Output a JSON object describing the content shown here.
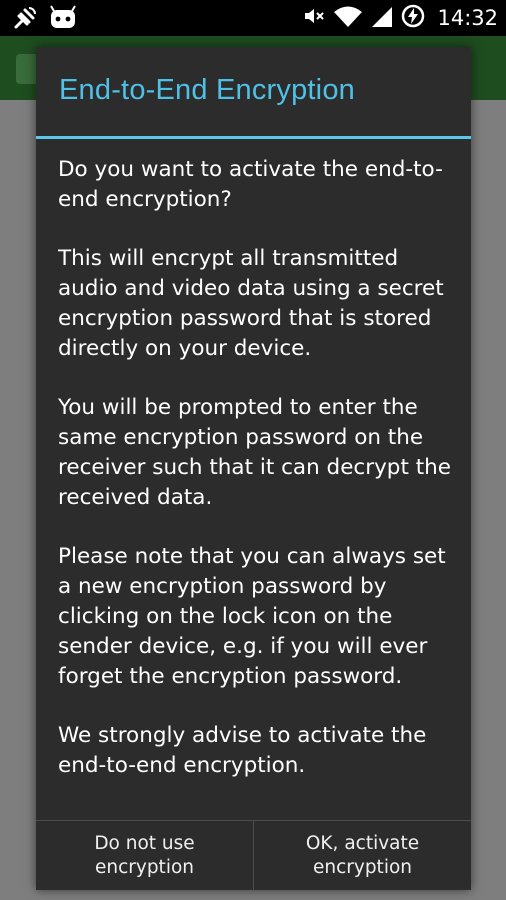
{
  "status_bar": {
    "time": "14:32",
    "icons": [
      "satellite-signal-icon",
      "android-face-icon",
      "mute-icon",
      "wifi-signal-icon",
      "battery-charging-icon"
    ]
  },
  "dialog": {
    "title": "End-to-End Encryption",
    "accent_color": "#4fc0e6",
    "paragraphs": [
      "Do you want to activate the end-to-end encryption?",
      "This will encrypt all transmitted audio and video data using a secret encryption password that is stored directly on your device.",
      "You will be prompted to enter the same encryption password on the receiver such that it can decrypt the received data.",
      "Please note that you can always set a new encryption password by clicking on the lock icon on the sender device, e.g. if you will ever forget the encryption password.",
      "We strongly advise to activate the end-to-end encryption."
    ],
    "buttons": {
      "negative": "Do not use\nencryption",
      "positive": "OK, activate\nencryption"
    }
  }
}
